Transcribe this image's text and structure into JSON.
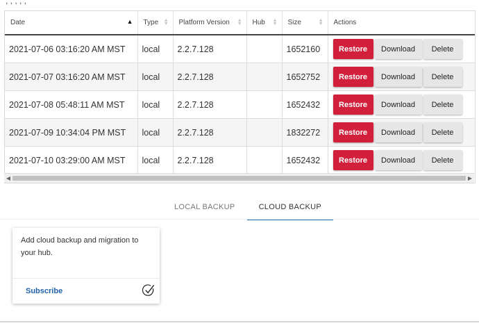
{
  "table": {
    "columns": [
      {
        "label": "Date"
      },
      {
        "label": "Type"
      },
      {
        "label": "Platform Version"
      },
      {
        "label": "Hub"
      },
      {
        "label": "Size"
      },
      {
        "label": "Actions"
      }
    ],
    "rows": [
      {
        "date": "2021-07-06 03:16:20 AM MST",
        "type": "local",
        "version": "2.2.7.128",
        "hub": "",
        "size": "1652160"
      },
      {
        "date": "2021-07-07 03:16:20 AM MST",
        "type": "local",
        "version": "2.2.7.128",
        "hub": "",
        "size": "1652752"
      },
      {
        "date": "2021-07-08 05:48:11 AM MST",
        "type": "local",
        "version": "2.2.7.128",
        "hub": "",
        "size": "1652432"
      },
      {
        "date": "2021-07-09 10:34:04 PM MST",
        "type": "local",
        "version": "2.2.7.128",
        "hub": "",
        "size": "1832272"
      },
      {
        "date": "2021-07-10 03:29:00 AM MST",
        "type": "local",
        "version": "2.2.7.128",
        "hub": "",
        "size": "1652432"
      }
    ],
    "buttons": {
      "restore": "Restore",
      "download": "Download",
      "delete": "Delete"
    }
  },
  "tabs": [
    {
      "label": "LOCAL BACKUP"
    },
    {
      "label": "CLOUD BACKUP"
    }
  ],
  "card": {
    "text": "Add cloud backup and migration to your hub.",
    "link": "Subscribe"
  },
  "colors": {
    "restore": "#d21f3c",
    "link": "#2362a6",
    "tab_underline": "#1f6fb5"
  }
}
